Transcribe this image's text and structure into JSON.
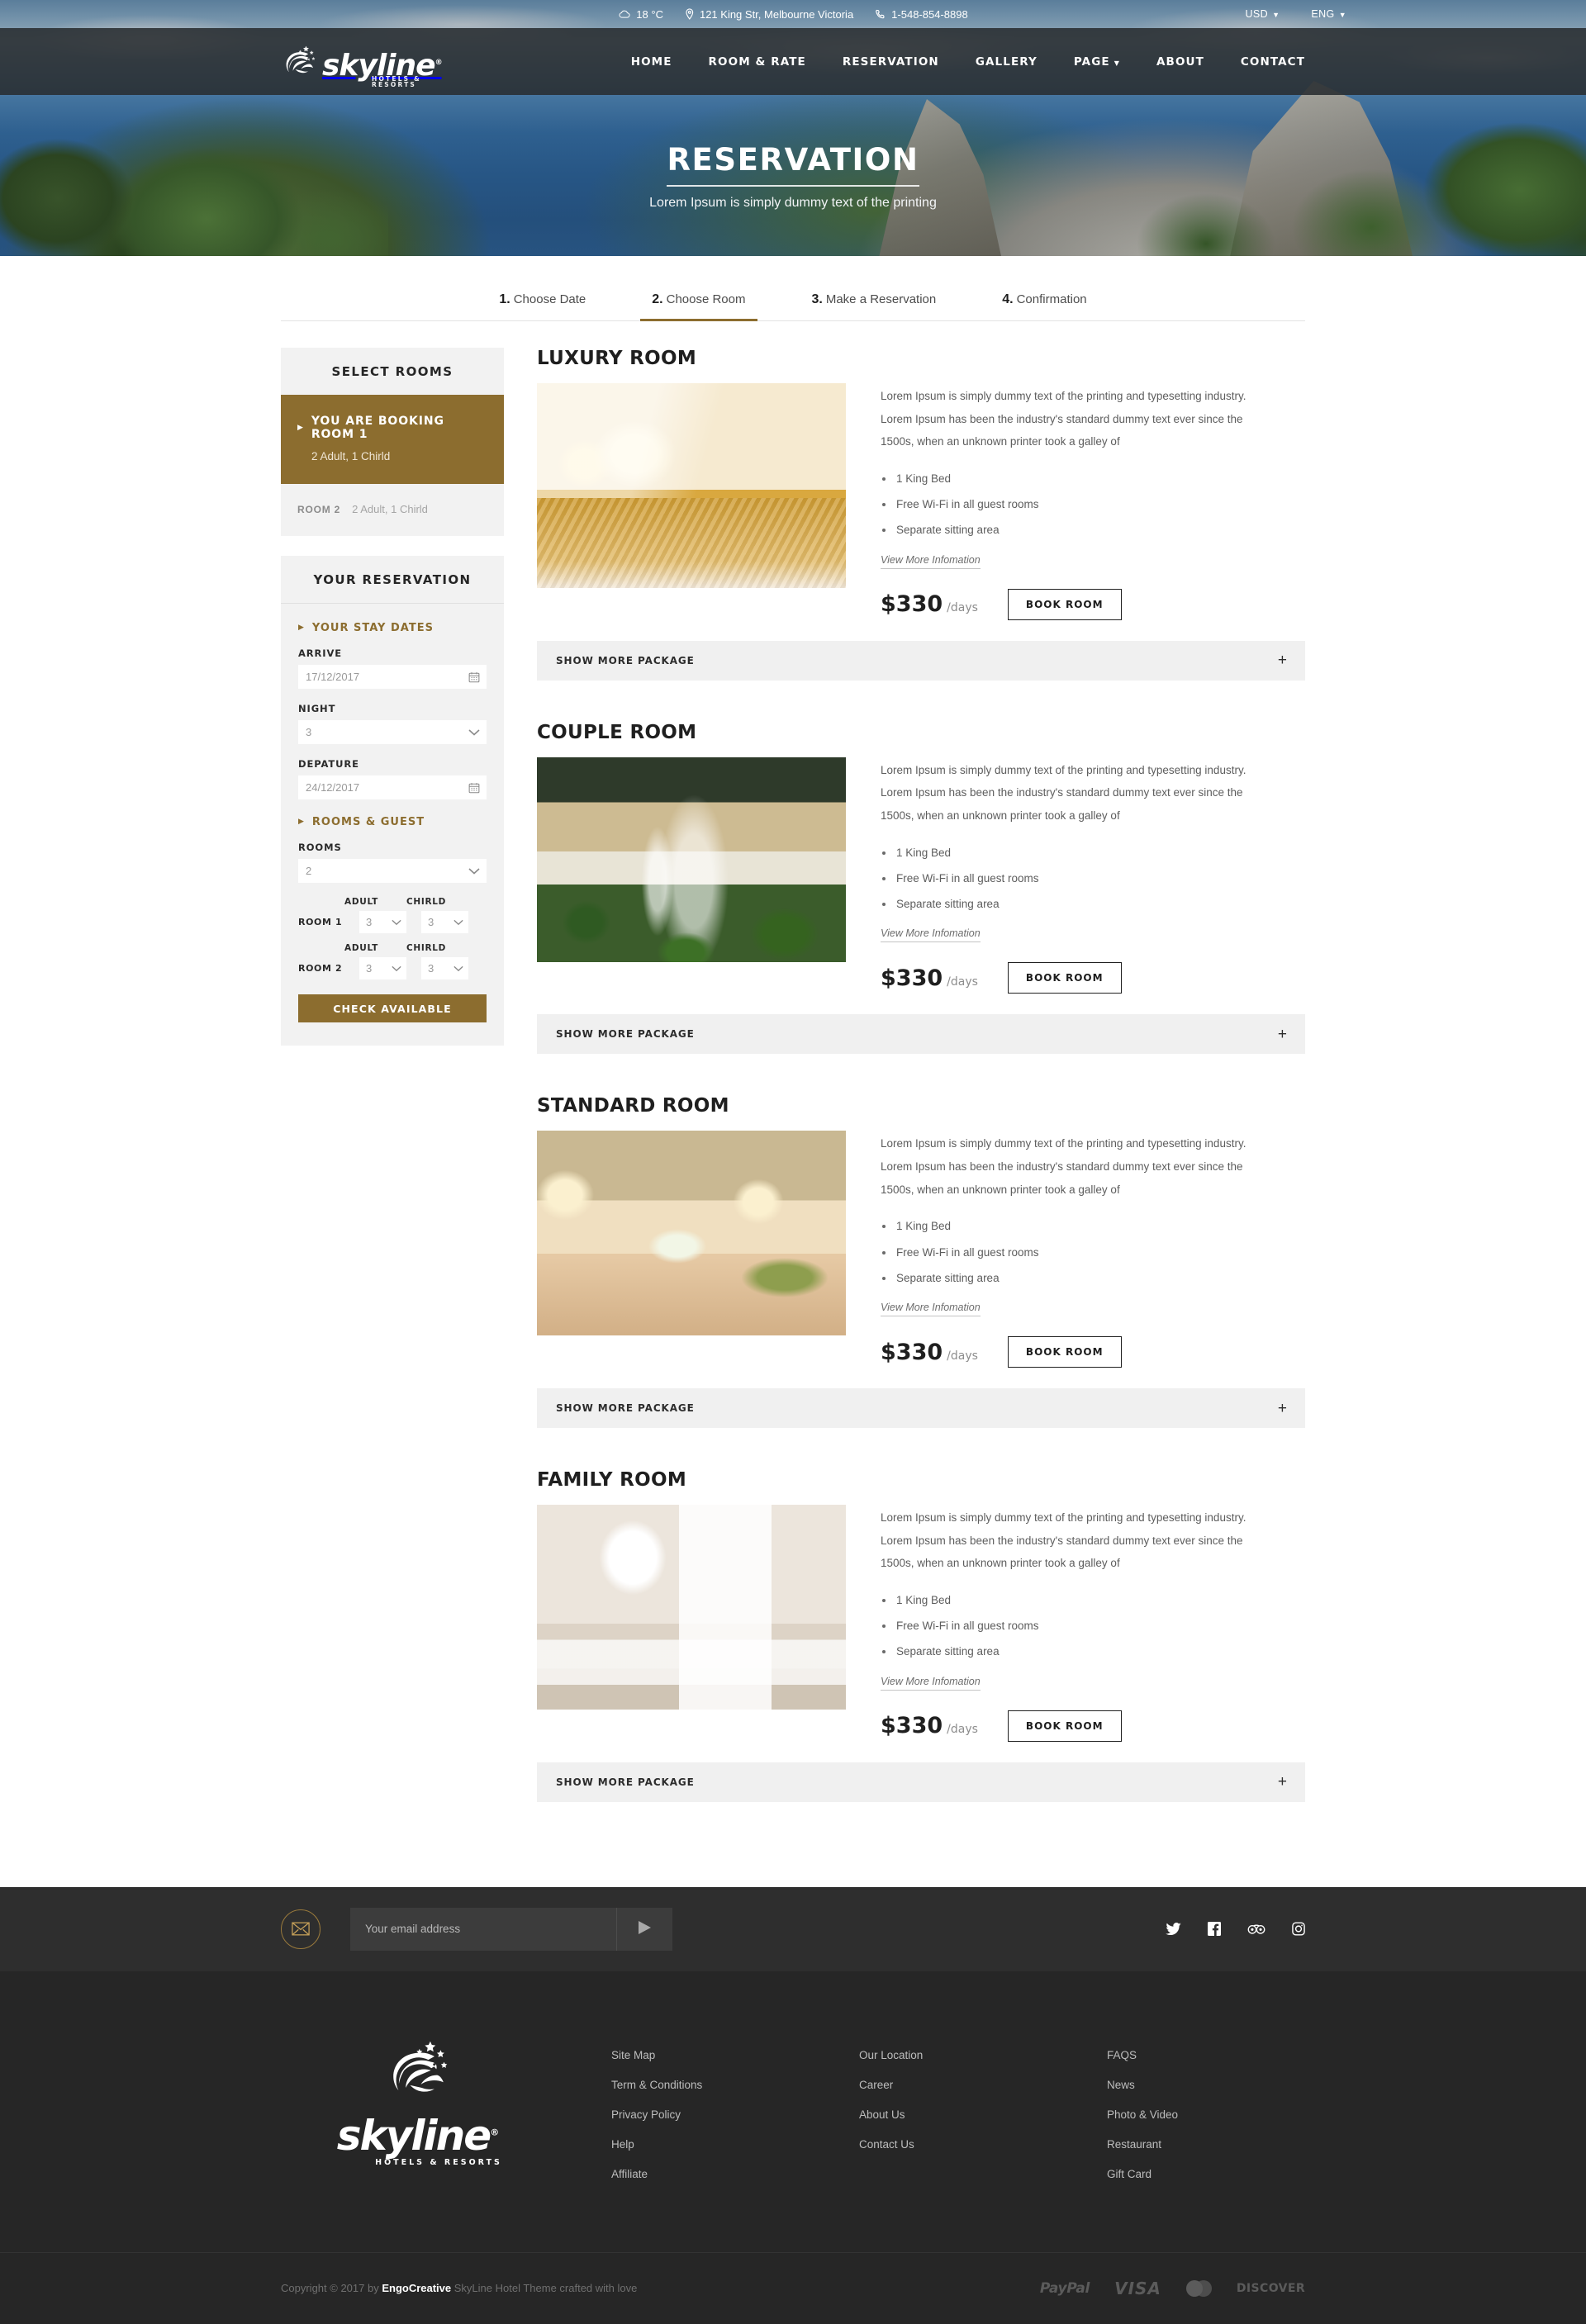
{
  "topbar": {
    "weather": "18 °C",
    "weather_icon": "cloud-icon",
    "address": "121 King Str, Melbourne Victoria",
    "address_icon": "location-pin-icon",
    "phone": "1-548-854-8898",
    "phone_icon": "phone-icon",
    "currency": "USD",
    "language": "ENG",
    "caret": "▼"
  },
  "brand": {
    "word": "skyline",
    "registered": "®",
    "tagline": "HOTELS & RESORTS"
  },
  "nav": {
    "items": [
      {
        "label": "HOME",
        "has_caret": false
      },
      {
        "label": "ROOM & RATE",
        "has_caret": false
      },
      {
        "label": "RESERVATION",
        "has_caret": false
      },
      {
        "label": "GALLERY",
        "has_caret": false
      },
      {
        "label": "PAGE",
        "has_caret": true
      },
      {
        "label": "ABOUT",
        "has_caret": false
      },
      {
        "label": "CONTACT",
        "has_caret": false
      }
    ],
    "caret": "▼"
  },
  "hero": {
    "title": "RESERVATION",
    "subtitle": "Lorem Ipsum is simply dummy text of the printing"
  },
  "steps": [
    {
      "num": "1.",
      "label": "Choose Date",
      "active": false
    },
    {
      "num": "2.",
      "label": "Choose Room",
      "active": true
    },
    {
      "num": "3.",
      "label": "Make a Reservation",
      "active": false
    },
    {
      "num": "4.",
      "label": "Confirmation",
      "active": false
    }
  ],
  "select_rooms": {
    "heading": "SELECT ROOMS",
    "active": {
      "title": "YOU ARE BOOKING ROOM 1",
      "guests": "2 Adult, 1 Chirld",
      "marker": "▶"
    },
    "other": {
      "label": "ROOM 2",
      "guests": "2 Adult, 1 Chirld"
    }
  },
  "reservation": {
    "heading": "YOUR RESERVATION",
    "stay_dates_title": "YOUR STAY DATES",
    "marker": "▶",
    "arrive_label": "ARRIVE",
    "arrive_value": "17/12/2017",
    "night_label": "NIGHT",
    "night_value": "3",
    "depature_label": "DEPATURE",
    "depature_value": "24/12/2017",
    "rooms_guest_title": "ROOMS & GUEST",
    "rooms_label": "ROOMS",
    "rooms_value": "2",
    "adult_label": "ADULT",
    "chirld_label": "CHIRLD",
    "room1_label": "ROOM 1",
    "room1_adult": "3",
    "room1_chirld": "3",
    "room2_label": "ROOM 2",
    "room2_adult": "3",
    "room2_chirld": "3",
    "check_button": "CHECK AVAILABLE",
    "calendar_icon": "calendar-icon",
    "chevron_icon": "chevron-down-icon"
  },
  "rooms": [
    {
      "title": "LUXURY ROOM",
      "description": "Lorem Ipsum is simply dummy text of the printing and typesetting industry. Lorem Ipsum has been the industry's standard dummy text ever since the 1500s, when an unknown printer took a galley of",
      "features": [
        "1 King Bed",
        "Free Wi-Fi in all guest rooms",
        "Separate sitting area"
      ],
      "more_link": "View More Infomation",
      "price": "$330",
      "price_unit": "/days",
      "book_label": "BOOK ROOM",
      "package_label": "SHOW MORE PACKAGE",
      "package_toggle": "+",
      "photo": "luxury"
    },
    {
      "title": "COUPLE ROOM",
      "description": "Lorem Ipsum is simply dummy text of the printing and typesetting industry. Lorem Ipsum has been the industry's standard dummy text ever since the 1500s, when an unknown printer took a galley of",
      "features": [
        "1 King Bed",
        "Free Wi-Fi in all guest rooms",
        "Separate sitting area"
      ],
      "more_link": "View More Infomation",
      "price": "$330",
      "price_unit": "/days",
      "book_label": "BOOK ROOM",
      "package_label": "SHOW MORE PACKAGE",
      "package_toggle": "+",
      "photo": "couple"
    },
    {
      "title": "STANDARD ROOM",
      "description": "Lorem Ipsum is simply dummy text of the printing and typesetting industry. Lorem Ipsum has been the industry's standard dummy text ever since the 1500s, when an unknown printer took a galley of",
      "features": [
        "1 King Bed",
        "Free Wi-Fi in all guest rooms",
        "Separate sitting area"
      ],
      "more_link": "View More Infomation",
      "price": "$330",
      "price_unit": "/days",
      "book_label": "BOOK ROOM",
      "package_label": "SHOW MORE PACKAGE",
      "package_toggle": "+",
      "photo": "standard"
    },
    {
      "title": "FAMILY ROOM",
      "description": "Lorem Ipsum is simply dummy text of the printing and typesetting industry. Lorem Ipsum has been the industry's standard dummy text ever since the 1500s, when an unknown printer took a galley of",
      "features": [
        "1 King Bed",
        "Free Wi-Fi in all guest rooms",
        "Separate sitting area"
      ],
      "more_link": "View More Infomation",
      "price": "$330",
      "price_unit": "/days",
      "book_label": "BOOK ROOM",
      "package_label": "SHOW MORE PACKAGE",
      "package_toggle": "+",
      "photo": "family"
    }
  ],
  "newsletter": {
    "icon": "envelope-icon",
    "placeholder": "Your email address",
    "submit_icon": "send-arrow-icon",
    "socials": [
      "twitter-icon",
      "facebook-icon",
      "tripadvisor-icon",
      "instagram-icon"
    ]
  },
  "footer": {
    "columns": [
      [
        "Site Map",
        "Term & Conditions",
        "Privacy Policy",
        "Help",
        "Affiliate"
      ],
      [
        "Our Location",
        "Career",
        "About Us",
        "Contact Us"
      ],
      [
        "FAQS",
        "News",
        "Photo & Video",
        "Restaurant",
        "Gift Card"
      ]
    ],
    "copyright_prefix": "Copyright © 2017 by ",
    "copyright_brand": "EngoCreative",
    "copyright_suffix": " SkyLine Hotel Theme crafted with love",
    "payments": [
      "PayPal",
      "VISA",
      "MasterCard",
      "DISCOVER"
    ]
  },
  "colors": {
    "accent_gold": "#8c6d2f",
    "dark_footer": "#262626",
    "newsletter_bg": "#2e2e2e",
    "card_bg": "#f2f2f2",
    "package_bar_bg": "#f0f0f0"
  }
}
